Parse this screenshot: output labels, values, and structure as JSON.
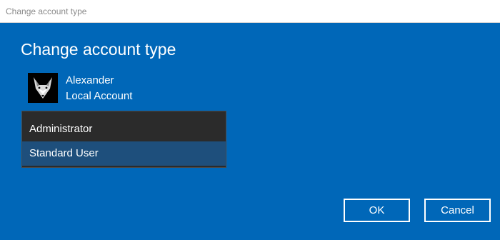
{
  "window": {
    "title": "Change account type"
  },
  "dialog": {
    "heading": "Change account type",
    "user": {
      "name": "Alexander",
      "account_type": "Local Account",
      "avatar_icon": "fox-avatar-icon"
    },
    "account_options": [
      "Administrator",
      "Standard User"
    ],
    "selected_option": "Standard User",
    "buttons": {
      "ok": "OK",
      "cancel": "Cancel"
    }
  },
  "colors": {
    "background": "#0067b8",
    "dropdown_bg": "#2b2b2b",
    "selected_bg": "#1e4f7c",
    "text": "#ffffff"
  }
}
